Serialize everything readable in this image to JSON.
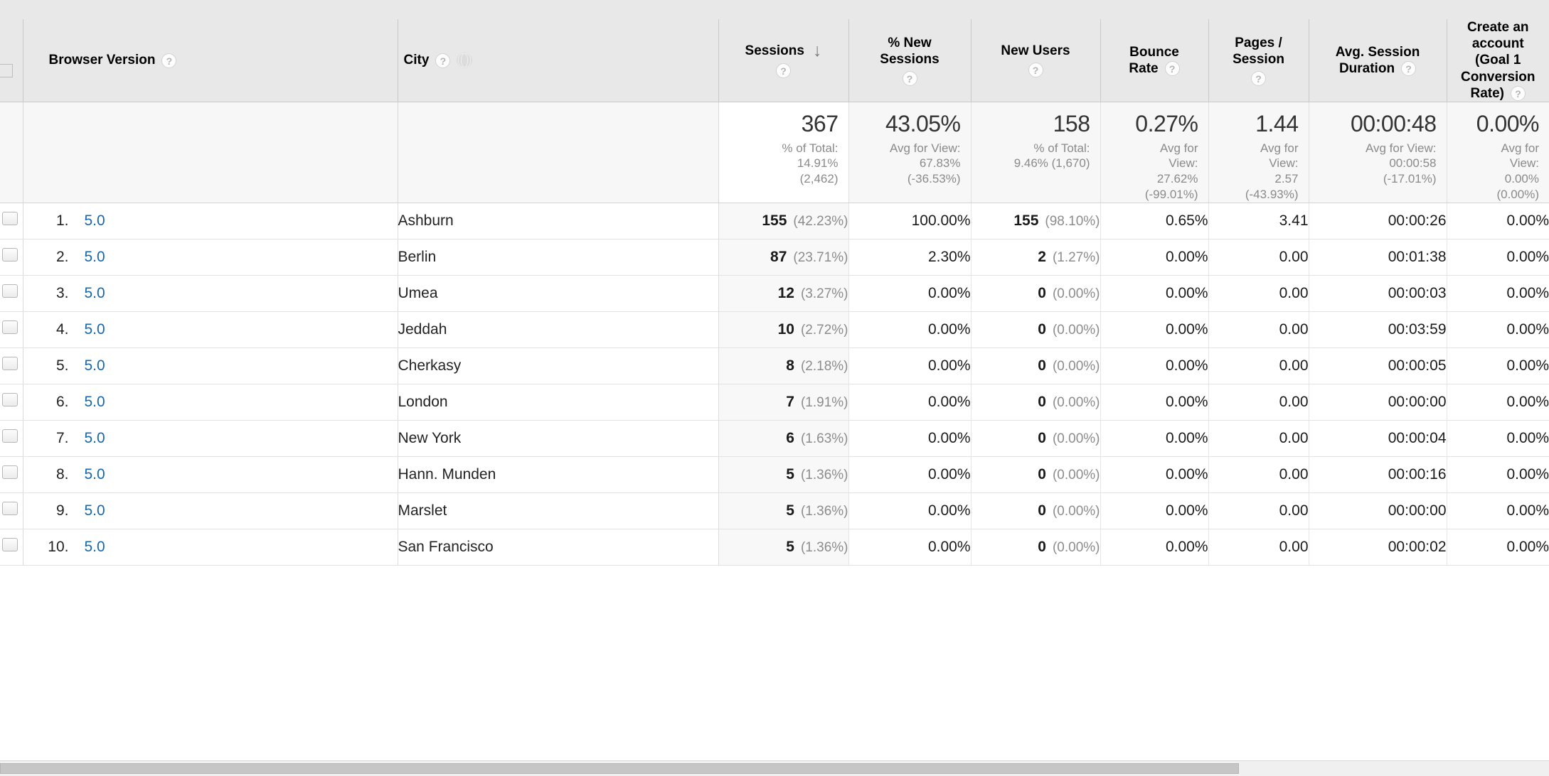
{
  "table": {
    "dimension_headers": [
      {
        "label": "Browser Version",
        "help_icon": "question-mark-icon",
        "has_globe": false
      },
      {
        "label": "City",
        "help_icon": "question-mark-icon",
        "has_globe": true,
        "globe_icon": "globe-icon"
      }
    ],
    "metric_headers": [
      {
        "label": "Sessions",
        "line2": "",
        "help_icon": "question-mark-icon",
        "sorted": true,
        "sort_arrow": "↓",
        "sort_direction": "descending"
      },
      {
        "label": "% New",
        "line2": "Sessions",
        "help_icon": "question-mark-icon",
        "sorted": false
      },
      {
        "label": "New Users",
        "line2": "",
        "help_icon": "question-mark-icon",
        "sorted": false
      },
      {
        "label": "Bounce",
        "line2": "Rate",
        "help_icon": "question-mark-icon",
        "sorted": false
      },
      {
        "label": "Pages /",
        "line2": "Session",
        "help_icon": "question-mark-icon",
        "sorted": false
      },
      {
        "label": "Avg. Session",
        "line2": "Duration",
        "help_icon": "question-mark-icon",
        "sorted": false
      },
      {
        "label": "Create an",
        "line2": "account",
        "line3": "(Goal 1",
        "line4": "Conversion",
        "line5": "Rate)",
        "help_icon": "question-mark-icon",
        "sorted": false
      }
    ],
    "summary": [
      {
        "value": "367",
        "sub1": "% of Total:",
        "sub2": "14.91%",
        "sub3": "(2,462)",
        "sorted": true
      },
      {
        "value": "43.05%",
        "sub1": "Avg for View:",
        "sub2": "67.83%",
        "sub3": "(-36.53%)",
        "sorted": false
      },
      {
        "value": "158",
        "sub1": "% of Total:",
        "sub2": "9.46% (1,670)",
        "sub3": "",
        "sorted": false
      },
      {
        "value": "0.27%",
        "sub1": "Avg for",
        "sub2": "View:",
        "sub3": "27.62%",
        "sub4": "(-99.01%)",
        "sorted": false
      },
      {
        "value": "1.44",
        "sub1": "Avg for",
        "sub2": "View:",
        "sub3": "2.57",
        "sub4": "(-43.93%)",
        "sorted": false
      },
      {
        "value": "00:00:48",
        "sub1": "Avg for View:",
        "sub2": "00:00:58",
        "sub3": "(-17.01%)",
        "sorted": false
      },
      {
        "value": "0.00%",
        "sub1": "Avg for",
        "sub2": "View:",
        "sub3": "0.00%",
        "sub4": "(0.00%)",
        "sorted": false
      }
    ],
    "rows": [
      {
        "index": "1.",
        "browser_version": "5.0",
        "city": "Ashburn",
        "sessions": "155",
        "sessions_pct": "(42.23%)",
        "pct_new_sessions": "100.00%",
        "new_users": "155",
        "new_users_pct": "(98.10%)",
        "bounce_rate": "0.65%",
        "pages_session": "3.41",
        "avg_session_duration": "00:00:26",
        "goal1_conversion_rate": "0.00%"
      },
      {
        "index": "2.",
        "browser_version": "5.0",
        "city": "Berlin",
        "sessions": "87",
        "sessions_pct": "(23.71%)",
        "pct_new_sessions": "2.30%",
        "new_users": "2",
        "new_users_pct": "(1.27%)",
        "bounce_rate": "0.00%",
        "pages_session": "0.00",
        "avg_session_duration": "00:01:38",
        "goal1_conversion_rate": "0.00%"
      },
      {
        "index": "3.",
        "browser_version": "5.0",
        "city": "Umea",
        "sessions": "12",
        "sessions_pct": "(3.27%)",
        "pct_new_sessions": "0.00%",
        "new_users": "0",
        "new_users_pct": "(0.00%)",
        "bounce_rate": "0.00%",
        "pages_session": "0.00",
        "avg_session_duration": "00:00:03",
        "goal1_conversion_rate": "0.00%"
      },
      {
        "index": "4.",
        "browser_version": "5.0",
        "city": "Jeddah",
        "sessions": "10",
        "sessions_pct": "(2.72%)",
        "pct_new_sessions": "0.00%",
        "new_users": "0",
        "new_users_pct": "(0.00%)",
        "bounce_rate": "0.00%",
        "pages_session": "0.00",
        "avg_session_duration": "00:03:59",
        "goal1_conversion_rate": "0.00%"
      },
      {
        "index": "5.",
        "browser_version": "5.0",
        "city": "Cherkasy",
        "sessions": "8",
        "sessions_pct": "(2.18%)",
        "pct_new_sessions": "0.00%",
        "new_users": "0",
        "new_users_pct": "(0.00%)",
        "bounce_rate": "0.00%",
        "pages_session": "0.00",
        "avg_session_duration": "00:00:05",
        "goal1_conversion_rate": "0.00%"
      },
      {
        "index": "6.",
        "browser_version": "5.0",
        "city": "London",
        "sessions": "7",
        "sessions_pct": "(1.91%)",
        "pct_new_sessions": "0.00%",
        "new_users": "0",
        "new_users_pct": "(0.00%)",
        "bounce_rate": "0.00%",
        "pages_session": "0.00",
        "avg_session_duration": "00:00:00",
        "goal1_conversion_rate": "0.00%"
      },
      {
        "index": "7.",
        "browser_version": "5.0",
        "city": "New York",
        "sessions": "6",
        "sessions_pct": "(1.63%)",
        "pct_new_sessions": "0.00%",
        "new_users": "0",
        "new_users_pct": "(0.00%)",
        "bounce_rate": "0.00%",
        "pages_session": "0.00",
        "avg_session_duration": "00:00:04",
        "goal1_conversion_rate": "0.00%"
      },
      {
        "index": "8.",
        "browser_version": "5.0",
        "city": "Hann. Munden",
        "sessions": "5",
        "sessions_pct": "(1.36%)",
        "pct_new_sessions": "0.00%",
        "new_users": "0",
        "new_users_pct": "(0.00%)",
        "bounce_rate": "0.00%",
        "pages_session": "0.00",
        "avg_session_duration": "00:00:16",
        "goal1_conversion_rate": "0.00%"
      },
      {
        "index": "9.",
        "browser_version": "5.0",
        "city": "Marslet",
        "sessions": "5",
        "sessions_pct": "(1.36%)",
        "pct_new_sessions": "0.00%",
        "new_users": "0",
        "new_users_pct": "(0.00%)",
        "bounce_rate": "0.00%",
        "pages_session": "0.00",
        "avg_session_duration": "00:00:00",
        "goal1_conversion_rate": "0.00%"
      },
      {
        "index": "10.",
        "browser_version": "5.0",
        "city": "San Francisco",
        "sessions": "5",
        "sessions_pct": "(1.36%)",
        "pct_new_sessions": "0.00%",
        "new_users": "0",
        "new_users_pct": "(0.00%)",
        "bounce_rate": "0.00%",
        "pages_session": "0.00",
        "avg_session_duration": "00:00:02",
        "goal1_conversion_rate": "0.00%"
      }
    ]
  },
  "colors": {
    "link": "#1667b1",
    "header_bg": "#e8e8e8",
    "summary_bg": "#f7f7f7",
    "sorted_cell_bg": "#f8f8f8",
    "muted_text": "#8c8c8c"
  }
}
